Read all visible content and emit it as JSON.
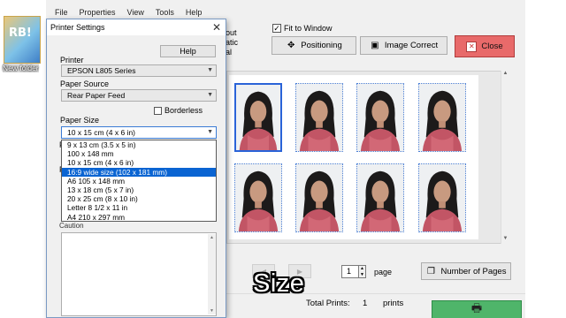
{
  "app": {
    "menu": [
      "File",
      "Properties",
      "View",
      "Tools",
      "Help"
    ],
    "partial_labels": [
      "out",
      "atic",
      "al"
    ],
    "fit_to_window": {
      "label": "Fit to Window",
      "checked": true
    },
    "buttons": {
      "positioning": "Positioning",
      "image_correct": "Image Correct",
      "close": "Close",
      "number_of_pages": "Number of Pages"
    },
    "page": {
      "value": "1",
      "label": "page"
    },
    "total_prints": {
      "label": "Total Prints:",
      "value": "1",
      "unit": "prints"
    },
    "caption": "Size"
  },
  "desktop": {
    "icon_label": "New folder",
    "thumb_text": "RB!"
  },
  "dialog": {
    "title": "Printer Settings",
    "help_label": "Help",
    "printer_label": "Printer",
    "printer_value": "EPSON L805 Series",
    "paper_source_label": "Paper Source",
    "paper_source_value": "Rear Paper Feed",
    "borderless_label": "Borderless",
    "paper_size_label": "Paper Size",
    "paper_size_value": "10 x 15 cm (4 x 6 in)",
    "hidden_label_letters": [
      "P",
      "P"
    ],
    "paper_size_options": [
      "9 x 13 cm (3.5 x 5 in)",
      "100 x 148 mm",
      "10 x 15 cm (4 x 6 in)",
      "16:9 wide size (102 x 181 mm)",
      "A6 105 x 148 mm",
      "13 x 18 cm (5 x 7 in)",
      "20 x 25 cm (8 x 10 in)",
      "Letter 8 1/2 x 11 in",
      "A4 210 x 297 mm"
    ],
    "highlighted_option_index": 3,
    "caution_label": "Caution"
  },
  "icons": {
    "close": "close-icon",
    "positioning": "crosshair-icon",
    "image_correct": "image-correct-icon",
    "close_button": "close-x-icon",
    "number_pages": "pages-icon",
    "printer": "printer-icon",
    "dropdown": "chevron-down-icon"
  },
  "colors": {
    "close_button": "#e86a6a",
    "print_button": "#4fb56a",
    "highlight": "#0a64d2",
    "selection_border": "#2a63d8"
  }
}
